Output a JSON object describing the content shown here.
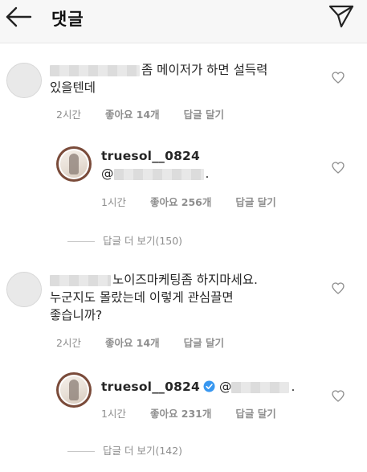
{
  "header": {
    "title": "댓글",
    "back_icon": "arrow-left-icon",
    "send_icon": "paper-plane-icon"
  },
  "comments": [
    {
      "text_line1": "좀 메이저가 하면 설득력",
      "text_line2": "있을텐데",
      "time": "2시간",
      "likes": "좋아요 14개",
      "reply": "답글 달기",
      "reply_item": {
        "username": "truesol__0824",
        "time": "1시간",
        "likes": "좋아요 256개",
        "reply": "답글 달기"
      },
      "more_replies": "답글 더 보기(150)"
    },
    {
      "text_line1": "노이즈마케팅좀 하지마세요.",
      "text_line2": "누군지도 몰랐는데 이렇게 관심끌면",
      "text_line3": "좋습니까?",
      "time": "2시간",
      "likes": "좋아요 14개",
      "reply": "답글 달기",
      "reply_item": {
        "username": "truesol__0824",
        "time": "1시간",
        "likes": "좋아요 231개",
        "reply": "답글 달기"
      },
      "more_replies": "답글 더 보기(142)"
    }
  ]
}
